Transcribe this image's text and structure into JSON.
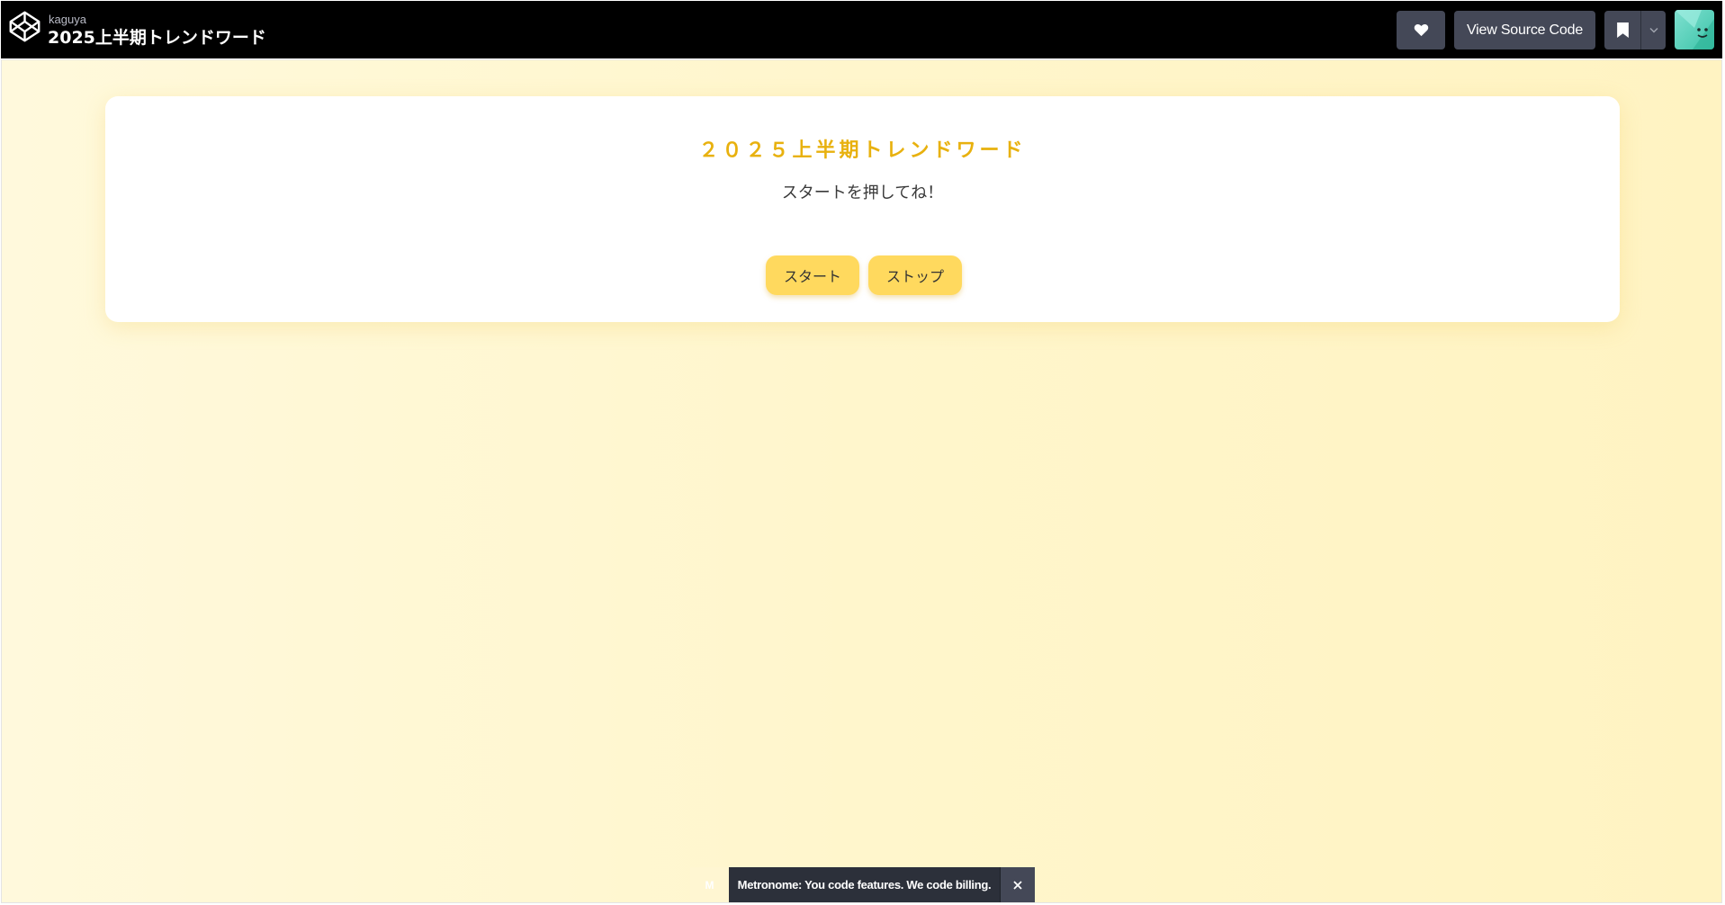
{
  "header": {
    "author": "kaguya",
    "title": "2025上半期トレンドワード",
    "view_source_label": "View Source Code",
    "icons": {
      "logo": "codepen-logo-icon",
      "heart": "heart-icon",
      "bookmark": "bookmark-icon",
      "dropdown": "chevron-down-icon",
      "avatar": "user-avatar"
    }
  },
  "card": {
    "title": "２０２５上半期トレンドワード",
    "message": "スタートを押してね！",
    "start_label": "スタート",
    "stop_label": "ストップ"
  },
  "ad": {
    "logo_text": "M",
    "text": "Metronome: You code features. We code billing.",
    "close_icon": "close-icon"
  },
  "colors": {
    "topbar": "#000000",
    "button_dark": "#444857",
    "accent_title": "#e8b10e",
    "button_yellow": "#ffd95e",
    "background_start": "#fff9dc",
    "background_end": "#fff3c2"
  }
}
